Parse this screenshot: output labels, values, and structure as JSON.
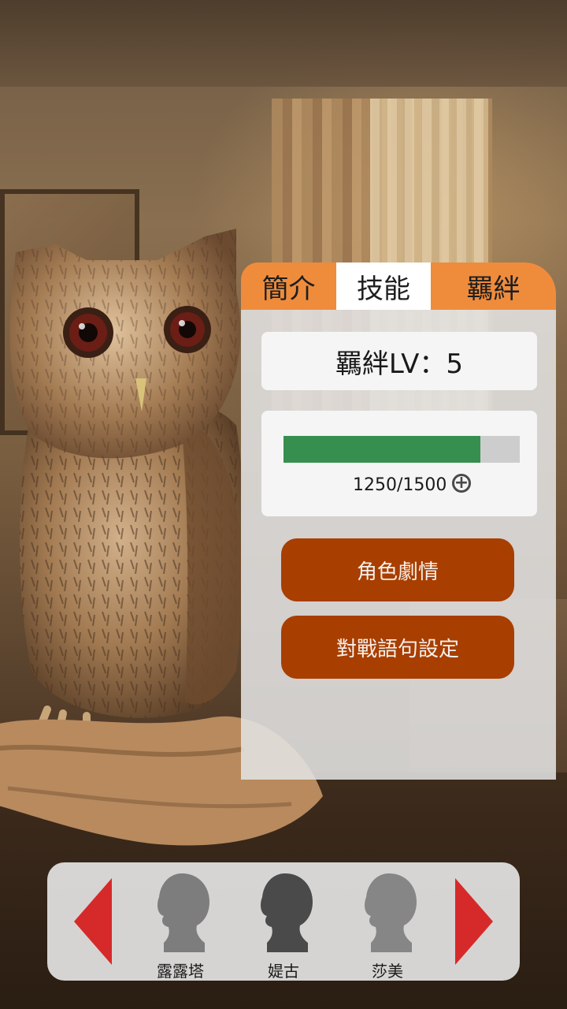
{
  "tabs": [
    {
      "label": "簡介",
      "active": false
    },
    {
      "label": "技能",
      "active": true
    },
    {
      "label": "羈絆",
      "active": false
    }
  ],
  "bond": {
    "level_text": "羈絆LV：5",
    "exp_text": "1250/1500",
    "exp_current": 1250,
    "exp_max": 1500
  },
  "buttons": {
    "story": "角色劇情",
    "battle_phrase": "對戰語句設定"
  },
  "characters": [
    {
      "name": "露露塔",
      "selected": false
    },
    {
      "name": "媞古",
      "selected": true
    },
    {
      "name": "莎美",
      "selected": false
    }
  ],
  "colors": {
    "tab_orange": "#ef8c3c",
    "button_brown": "#a83e00",
    "exp_green": "#368f4e",
    "arrow_red": "#d62a2a"
  }
}
